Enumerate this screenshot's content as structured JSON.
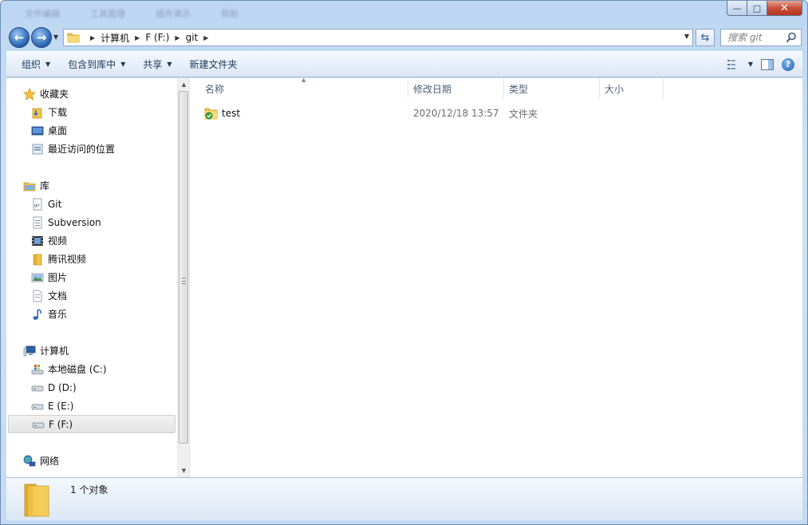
{
  "titlebar": {
    "blurred_tabs": [
      "文件编辑",
      "工具管理",
      "插件演示",
      "帮助"
    ],
    "minimize_symbol": "—",
    "maximize_symbol": "□",
    "close_symbol": "✕"
  },
  "address": {
    "crumbs": [
      "计算机",
      "F (F:)",
      "git"
    ],
    "search_placeholder": "搜索 git"
  },
  "toolbar": {
    "organize": "组织",
    "include_in_library": "包含到库中",
    "share": "共享",
    "new_folder": "新建文件夹"
  },
  "sidebar": {
    "favorites": {
      "label": "收藏夹",
      "items": [
        "下载",
        "桌面",
        "最近访问的位置"
      ]
    },
    "libraries": {
      "label": "库",
      "items": [
        "Git",
        "Subversion",
        "视频",
        "腾讯视频",
        "图片",
        "文档",
        "音乐"
      ]
    },
    "computer": {
      "label": "计算机",
      "items": [
        "本地磁盘 (C:)",
        "D (D:)",
        "E (E:)",
        "F (F:)"
      ],
      "selected": "F (F:)"
    },
    "network": {
      "label": "网络"
    }
  },
  "columns": {
    "name": "名称",
    "date": "修改日期",
    "type": "类型",
    "size": "大小"
  },
  "files": [
    {
      "name": "test",
      "modified": "2020/12/18 13:57",
      "type": "文件夹",
      "size": ""
    }
  ],
  "status": {
    "count": "1 个对象"
  },
  "colors": {
    "accent": "#2b67b5",
    "folder": "#f0c34e",
    "git_ok": "#3aa33a"
  }
}
